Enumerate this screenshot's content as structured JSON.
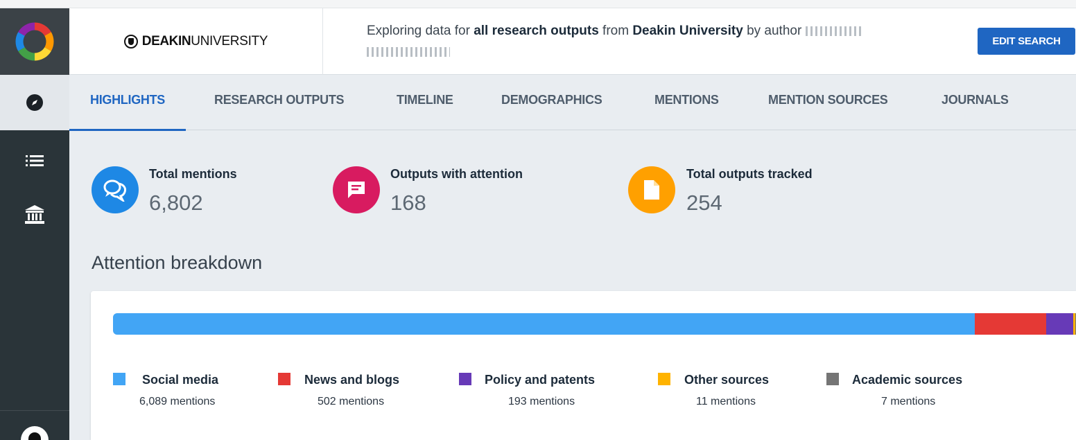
{
  "header": {
    "brand_bold": "DEAKIN",
    "brand_light": "UNIVERSITY",
    "explore_prefix": "Exploring data for ",
    "explore_bold1": "all research outputs",
    "explore_mid": " from ",
    "explore_bold2": "Deakin University",
    "explore_suffix": " by author",
    "edit_label": "EDIT SEARCH"
  },
  "sidebar": {
    "icons": [
      "altmetric-logo",
      "compass-icon",
      "list-icon",
      "institution-icon",
      "user-icon"
    ]
  },
  "tabs": [
    "HIGHLIGHTS",
    "RESEARCH OUTPUTS",
    "TIMELINE",
    "DEMOGRAPHICS",
    "MENTIONS",
    "MENTION SOURCES",
    "JOURNALS"
  ],
  "active_tab": "HIGHLIGHTS",
  "stats": [
    {
      "label": "Total mentions",
      "value": "6,802",
      "icon": "chat-bubbles-icon",
      "color": "#1e88e5"
    },
    {
      "label": "Outputs with attention",
      "value": "168",
      "icon": "message-icon",
      "color": "#d81b60"
    },
    {
      "label": "Total outputs tracked",
      "value": "254",
      "icon": "document-icon",
      "color": "#ffa000"
    }
  ],
  "breakdown": {
    "title": "Attention breakdown",
    "items": [
      {
        "label": "Social media",
        "count": "6,089 mentions",
        "value": 6089,
        "color": "#42a5f5"
      },
      {
        "label": "News and blogs",
        "count": "502 mentions",
        "value": 502,
        "color": "#e53935"
      },
      {
        "label": "Policy and patents",
        "count": "193 mentions",
        "value": 193,
        "color": "#673ab7"
      },
      {
        "label": "Other sources",
        "count": "11 mentions",
        "value": 11,
        "color": "#ffb300"
      },
      {
        "label": "Academic sources",
        "count": "7 mentions",
        "value": 7,
        "color": "#757575"
      }
    ]
  }
}
